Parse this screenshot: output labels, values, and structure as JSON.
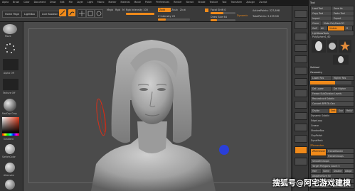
{
  "menu": [
    "Alpha",
    "Brush",
    "Color",
    "Document",
    "Draw",
    "Edit",
    "File",
    "Layer",
    "Light",
    "Macro",
    "Marker",
    "Material",
    "Movie",
    "Picker",
    "Preferences",
    "Render",
    "Stencil",
    "Stroke",
    "Texture",
    "Tool",
    "Transform",
    "Zplugin",
    "Zscript"
  ],
  "shelf": {
    "home_page": "Home Page",
    "lightbox": "LightBox",
    "live_boolean": "Live Boolean",
    "mrgb": "Mrgb",
    "rgb": "Rgb",
    "m": "M",
    "zadd": "Zadd",
    "zsub": "Zsub",
    "zcut": "Zcut",
    "rgb_intensity": "Rgb Intensity 100",
    "z_intensity": "Z Intensity 25",
    "focal_shift": "Focal Shift 0",
    "draw_size": "Draw Size 64",
    "dynamic": "Dynamic",
    "active_points": "ActivePoints: 327,898",
    "total_points": "TotalPoints: 3.195 Mil"
  },
  "lefttray": {
    "brush_label": "Move",
    "alpha_label": "Alpha Off",
    "texture_label": "Texture Off",
    "material_label": "MatCap Gray",
    "gradient_label": "Gradient",
    "switch_label": "SwitchColor",
    "alternate_label": "Alternate",
    "color_accent": "#e23a1a"
  },
  "rightpanel": {
    "title": "Tool",
    "load_tool": "Load Tool",
    "save_as": "Save As",
    "copy_tool": "Copy Tool",
    "paste_tool": "Paste Tool",
    "import": "Import",
    "export": "Export",
    "clone": "Clone",
    "make_polymesh": "Make PolyMesh3D",
    "goz": "GoZ",
    "all": "All",
    "visible": "Visible",
    "r": "R",
    "lightbox_tools": "Lightbox▸Tools",
    "tool_name": "PolySphere1_60",
    "subtool": "Subtool",
    "geometry": "Geometry",
    "lower_res": "Lower Res",
    "higher_res": "Higher Res",
    "sdiv": "SDiv",
    "del_lower": "Del Lower",
    "del_higher": "Del Higher",
    "freeze_subdiv": "Freeze SubDivision Levels",
    "reconstruct": "Reconstruct Subdiv",
    "convert_bpr": "Convert BPR To Geo",
    "divide": "Divide",
    "smt": "Smt",
    "suv": "Suv",
    "reuv": "ReUV",
    "dynamic_subdiv": "Dynamic Subdiv",
    "edgeloop": "EdgeLoop",
    "crease": "Crease",
    "shadowbox": "ShadowBox",
    "claypolish": "ClayPolish",
    "dynamesh": "DynaMesh",
    "zremesher": "ZRemesher",
    "freeze_border": "FreezeBorder",
    "freeze_groups": "FreezeGroups",
    "smooth_groups": "SmoothGroups",
    "target_polycount": "Target Polygons Count 5",
    "half": "Half",
    "same": "Same",
    "double": "Double",
    "adapt": "Adapt",
    "adaptive_size": "AdaptiveSize 50",
    "curves_strength": "Curves Strength 50",
    "use_polypaint": "Use Polypaint",
    "color_density": "ColorDensity"
  },
  "canvas": {
    "bg": "#4b4b4b",
    "accent_dot": "#2a3fd9"
  },
  "watermark": "搜狐号@阿宅游戏建模"
}
